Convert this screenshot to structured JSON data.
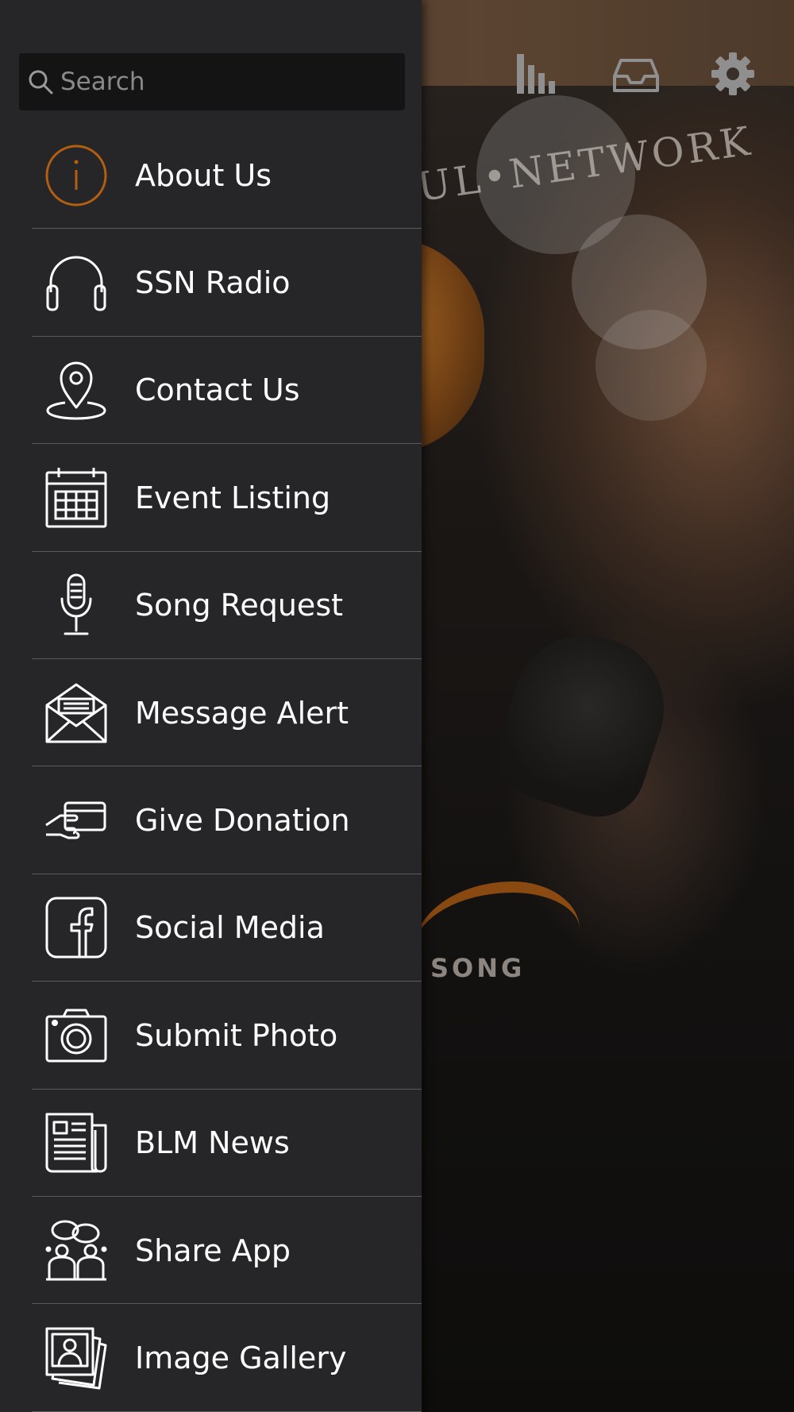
{
  "search": {
    "placeholder": "Search"
  },
  "background": {
    "visible_text": "SONG",
    "logo_text": "UL•NETWORK"
  },
  "top_icons": [
    "equalizer-icon",
    "inbox-icon",
    "gear-icon"
  ],
  "colors": {
    "drawer": "#262628",
    "accent": "#b35f12",
    "divider": "#5a5a5c",
    "text": "#ffffff"
  },
  "menu": {
    "items": [
      {
        "label": "About Us",
        "icon": "info-icon"
      },
      {
        "label": "SSN Radio",
        "icon": "headphones-icon"
      },
      {
        "label": "Contact Us",
        "icon": "map-pin-icon"
      },
      {
        "label": "Event Listing",
        "icon": "calendar-icon"
      },
      {
        "label": "Song Request",
        "icon": "microphone-icon"
      },
      {
        "label": "Message Alert",
        "icon": "envelope-icon"
      },
      {
        "label": "Give Donation",
        "icon": "hand-card-icon"
      },
      {
        "label": "Social Media",
        "icon": "facebook-icon"
      },
      {
        "label": "Submit Photo",
        "icon": "camera-icon"
      },
      {
        "label": "BLM News",
        "icon": "newspaper-icon"
      },
      {
        "label": "Share App",
        "icon": "chat-people-icon"
      },
      {
        "label": "Image Gallery",
        "icon": "photo-gallery-icon"
      }
    ]
  }
}
